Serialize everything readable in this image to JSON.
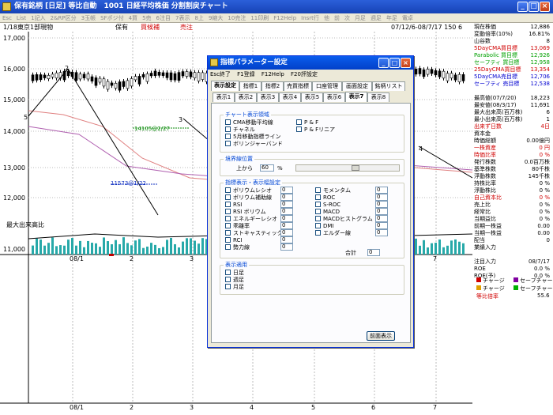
{
  "window": {
    "title": "保有銘柄 [日足] 等比自動　1001 日経平均株価 分割割戻チャート",
    "min_label": "_",
    "max_label": "□",
    "close_label": "×"
  },
  "menubar": [
    "Esc",
    "List",
    "1記入",
    "2&RP区分",
    "3玉帳",
    "SFポジ付",
    "4買",
    "5売",
    "6注目",
    "7表示",
    "8上",
    "9縮大",
    "10売注",
    "11印刷",
    "F12Help",
    "Insrt行",
    "他",
    "前",
    "次",
    "月足",
    "週足",
    "年足",
    "電卓"
  ],
  "symbol_bar": {
    "page": "1/18",
    "name": "東京1部現物",
    "status1": "保有",
    "status2": "買候補",
    "status3": "売注",
    "date_range": "07/12/6-08/7/17 150",
    "scale_num": "6"
  },
  "price_axis": [
    "17,000",
    "16,000",
    "15,000",
    "14,000",
    "13,000",
    "12,000",
    "11,000"
  ],
  "chart_annotations": {
    "a5": "5",
    "a2": "2",
    "a3": "3",
    "a4": "4",
    "hi": "14105@2/27",
    "lo": "11573@1/22",
    "volume_label": "最大出来高比"
  },
  "x_axis_top": [
    "08/1",
    "2",
    "3",
    "4",
    "5",
    "6",
    "7"
  ],
  "x_axis_bottom": [
    "08/1",
    "2",
    "3",
    "4",
    "5",
    "6",
    "7"
  ],
  "stats": [
    {
      "label": "現在株価",
      "value": "12,886",
      "color": "#000"
    },
    {
      "label": "変動倍率(10%)",
      "value": "16.81%",
      "color": "#000"
    },
    {
      "label": "山谷数",
      "value": "8",
      "color": "#000"
    },
    {
      "label": "5DayCMA買目標",
      "value": "13,069",
      "color": "#d00000"
    },
    {
      "label": "Parabolic 買目標",
      "value": "12,926",
      "color": "#00a000"
    },
    {
      "label": "セーフティ 買目標",
      "value": "12,958",
      "color": "#00a000"
    },
    {
      "label": "25DayCMA買目標",
      "value": "13,354",
      "color": "#d00000"
    },
    {
      "label": "5DayCMA売目標",
      "value": "12,706",
      "color": "#0000d0"
    },
    {
      "label": "セーフティ 売目標",
      "value": "12,538",
      "color": "#0000d0"
    },
    {
      "label": "",
      "value": "",
      "color": "#000"
    },
    {
      "label": "最高値(07/7/20)",
      "value": "18,223",
      "color": "#000"
    },
    {
      "label": "最安値(08/3/17)",
      "value": "11,691",
      "color": "#000"
    },
    {
      "label": "最大出来高(百万株)",
      "value": "6",
      "color": "#000"
    },
    {
      "label": "最小出来高(百万株)",
      "value": "1",
      "color": "#000"
    },
    {
      "label": "出来ず日数",
      "value": "4日",
      "color": "#d00000"
    },
    {
      "label": "資本金",
      "value": "",
      "color": "#000"
    },
    {
      "label": "時価総額",
      "value": "0.00億円",
      "color": "#000"
    },
    {
      "label": "一株資産",
      "value": "0 円",
      "color": "#d00000"
    },
    {
      "label": "時価比率",
      "value": "0 %",
      "color": "#d00000"
    },
    {
      "label": "発行株数",
      "value": "0.0百万株",
      "color": "#000"
    },
    {
      "label": "基準株数",
      "value": "80千株",
      "color": "#000"
    },
    {
      "label": "浮動株数",
      "value": "145千株",
      "color": "#000"
    },
    {
      "label": "持株比率",
      "value": "0 %",
      "color": "#000"
    },
    {
      "label": "浮動株比",
      "value": "0 %",
      "color": "#000"
    },
    {
      "label": "自己資本比",
      "value": "0 %",
      "color": "#d00000"
    },
    {
      "label": "売上比",
      "value": "0 %",
      "color": "#000"
    },
    {
      "label": "経常比",
      "value": "0 %",
      "color": "#000"
    },
    {
      "label": "当期益比",
      "value": "0 %",
      "color": "#000"
    },
    {
      "label": "前期一株益",
      "value": "0.00",
      "color": "#000"
    },
    {
      "label": "当期一株益",
      "value": "0.00",
      "color": "#000"
    },
    {
      "label": "配当",
      "value": "0",
      "color": "#000"
    },
    {
      "label": "業績入力",
      "value": "",
      "color": "#000"
    },
    {
      "label": "",
      "value": "",
      "color": "#000"
    },
    {
      "label": "注目入力",
      "value": "08/7/17",
      "color": "#000"
    },
    {
      "label": "ROE",
      "value": "0.0 %",
      "color": "#000"
    },
    {
      "label": "ROE(予)",
      "value": "0.0 %",
      "color": "#000"
    }
  ],
  "legend": {
    "a": "チャージ",
    "b": "セーフチャージ",
    "c": "チャージ",
    "d": "セーフチャージ",
    "e": "等比倍率",
    "e_value": "55.6"
  },
  "dialog": {
    "title": "指標パラメーター設定",
    "menu": [
      "Esc終了",
      "F1登録",
      "F12Help",
      "F20評設定"
    ],
    "tabs_row1": [
      "表示設定",
      "指標1",
      "指標2",
      "売買指標",
      "口座管理",
      "画面設定",
      "銘柄リスト"
    ],
    "tabs_row2": [
      "表示1",
      "表示2",
      "表示3",
      "表示4",
      "表示5",
      "表示6",
      "表示7",
      "表示8"
    ],
    "group1_title": "チャート表示領域",
    "group1_items": [
      "CMA移動平均線",
      "チャネル",
      "5月移動指標ライン",
      "ボリンジャーバンド"
    ],
    "group1_items_right": [
      "P & F",
      "P & Fリニア"
    ],
    "group2_title": "境界線位置",
    "border_label": "上から",
    "border_value": "60",
    "border_unit": "%",
    "group3_title": "指標表示・表示幅設定",
    "left_indicators": [
      "ボリウムレシオ",
      "ボリウム補助線",
      "RSI",
      "RSI ボリウム",
      "エネルギーレシオ",
      "乖離率",
      "ストキャスティック",
      "RCI",
      "勢力線"
    ],
    "left_values": [
      "0",
      "0",
      "0",
      "0",
      "0",
      "0",
      "0",
      "0",
      "0"
    ],
    "right_indicators": [
      "モメンタム",
      "ROC",
      "S-ROC",
      "MACD",
      "MACDヒストグラム",
      "DMI",
      "エルダー線"
    ],
    "right_values": [
      "0",
      "0",
      "0",
      "0",
      "0",
      "0",
      "0"
    ],
    "total_label": "合計",
    "total_value": "0",
    "group4_title": "表示適用",
    "apply_items": [
      "日足",
      "週足",
      "月足"
    ],
    "prev_button": "前面表示"
  }
}
